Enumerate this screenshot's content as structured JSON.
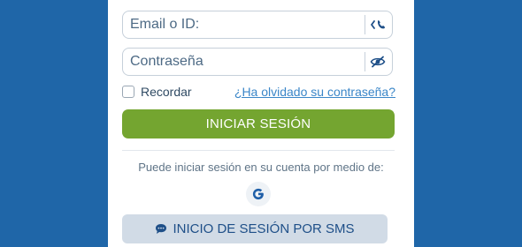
{
  "login_form": {
    "id_field_placeholder": "Email o ID:",
    "password_field_placeholder": "Contraseña",
    "remember_label": "Recordar",
    "forgot_password_link": "¿Ha olvidado su contraseña?",
    "login_button": "INICIAR SESIÓN",
    "alt_login_hint": "Puede iniciar sesión en su cuenta por medio de:",
    "google_icon": "google-icon",
    "sms_button": "INICIO DE SESIÓN POR SMS"
  },
  "colors": {
    "background": "#1f66a8",
    "primary_button": "#74a530",
    "secondary_button": "#d1dbe6",
    "link": "#3a86c8"
  }
}
